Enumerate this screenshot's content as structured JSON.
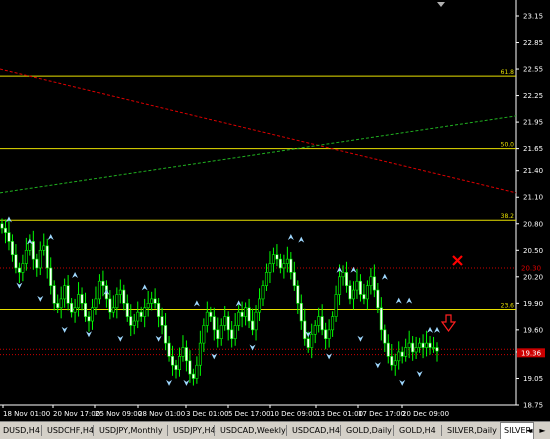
{
  "chart_data": {
    "type": "candlestick",
    "y_ticks": [
      "23.15",
      "22.85",
      "22.55",
      "22.25",
      "21.95",
      "21.65",
      "21.40",
      "21.10",
      "20.80",
      "20.50",
      "20.20",
      "19.90",
      "19.60",
      "19.35",
      "19.05",
      "18.75"
    ],
    "x_ticks": [
      "18 Nov 01:00",
      "20 Nov 17:00",
      "25 Nov 09:00",
      "28 Nov 01:00",
      "3 Dec 01:00",
      "5 Dec 17:00",
      "10 Dec 09:00",
      "13 Dec 01:00",
      "17 Dec 17:00",
      "20 Dec 09:00"
    ],
    "fib_levels": [
      {
        "label": "61.8",
        "price": 22.47
      },
      {
        "label": "50.0",
        "price": 21.65
      },
      {
        "label": "38.2",
        "price": 20.84
      },
      {
        "label": "23.6",
        "price": 19.83
      }
    ],
    "price_labels": [
      {
        "text": "20.30",
        "price": 20.3,
        "color": "#dd0000"
      },
      {
        "text": "19.36",
        "price": 19.36,
        "color": "#ffffff",
        "bg": "#000000"
      },
      {
        "text": "19.36",
        "price": 19.34,
        "color": "#ffffff",
        "bg": "#cc0000"
      }
    ],
    "red_line": {
      "from_price": 22.55,
      "to_price": 21.15
    },
    "green_line": {
      "from_price": 21.15,
      "to_price": 22.02
    },
    "close_series": [
      20.75,
      20.7,
      20.6,
      20.45,
      20.3,
      20.25,
      20.35,
      20.5,
      20.6,
      20.4,
      20.3,
      20.5,
      20.55,
      20.3,
      20.1,
      19.9,
      19.85,
      19.95,
      20.1,
      19.9,
      19.8,
      19.85,
      20.0,
      19.9,
      19.75,
      19.7,
      19.85,
      19.95,
      20.15,
      20.1,
      19.95,
      19.8,
      19.85,
      20.0,
      20.05,
      19.9,
      19.75,
      19.65,
      19.7,
      19.8,
      19.75,
      19.85,
      19.9,
      19.95,
      19.9,
      19.75,
      19.65,
      19.45,
      19.3,
      19.2,
      19.15,
      19.3,
      19.4,
      19.25,
      19.1,
      19.05,
      19.2,
      19.45,
      19.65,
      19.8,
      19.75,
      19.6,
      19.5,
      19.65,
      19.75,
      19.6,
      19.5,
      19.65,
      19.8,
      19.75,
      19.85,
      19.7,
      19.6,
      19.8,
      19.95,
      20.1,
      20.25,
      20.35,
      20.45,
      20.4,
      20.3,
      20.35,
      20.4,
      20.25,
      20.1,
      19.9,
      19.7,
      19.5,
      19.4,
      19.55,
      19.65,
      19.75,
      19.6,
      19.5,
      19.6,
      19.75,
      20.0,
      20.2,
      20.25,
      20.1,
      19.95,
      20.05,
      20.15,
      20.0,
      19.95,
      20.1,
      20.2,
      20.05,
      19.85,
      19.6,
      19.45,
      19.3,
      19.2,
      19.25,
      19.35,
      19.3,
      19.4,
      19.45,
      19.35,
      19.4,
      19.45,
      19.4,
      19.45,
      19.4,
      19.4,
      19.36
    ]
  },
  "arrows_up": [
    [
      2,
      20.85
    ],
    [
      8,
      20.6
    ],
    [
      14,
      20.65
    ],
    [
      21,
      20.22
    ],
    [
      30,
      20.03
    ],
    [
      41,
      20.08
    ],
    [
      56,
      19.9
    ],
    [
      68,
      19.9
    ],
    [
      83,
      20.65
    ],
    [
      86,
      20.62
    ],
    [
      97,
      20.28
    ],
    [
      101,
      20.28
    ],
    [
      110,
      20.2
    ],
    [
      114,
      19.93
    ],
    [
      117,
      19.93
    ],
    [
      123,
      19.6
    ],
    [
      125,
      19.6
    ]
  ],
  "arrows_down": [
    [
      5,
      20.1
    ],
    [
      11,
      19.95
    ],
    [
      18,
      19.6
    ],
    [
      25,
      19.55
    ],
    [
      34,
      19.5
    ],
    [
      45,
      19.5
    ],
    [
      48,
      19.0
    ],
    [
      53,
      19.0
    ],
    [
      61,
      19.3
    ],
    [
      72,
      19.4
    ],
    [
      88,
      19.55
    ],
    [
      94,
      19.3
    ],
    [
      103,
      19.5
    ],
    [
      108,
      19.2
    ],
    [
      115,
      19.0
    ],
    [
      120,
      19.1
    ]
  ],
  "annotations": {
    "cross_color": "#ff0000",
    "down_arrow_color": "#ff2020"
  },
  "tabs": [
    {
      "label": "DUSD,H4",
      "active": false
    },
    {
      "label": "USDCHF,H4",
      "active": false
    },
    {
      "label": "USDJPY,Monthly",
      "active": false
    },
    {
      "label": "USDJPY,H4",
      "active": false
    },
    {
      "label": "USDCAD,Weekly",
      "active": false
    },
    {
      "label": "USDCAD,H4",
      "active": false
    },
    {
      "label": "GOLD,Daily",
      "active": false
    },
    {
      "label": "GOLD,H4",
      "active": false
    },
    {
      "label": "SILVER,Daily",
      "active": false
    },
    {
      "label": "SILVER",
      "active": true
    }
  ],
  "nav": {
    "left": "◄",
    "right": "►"
  }
}
